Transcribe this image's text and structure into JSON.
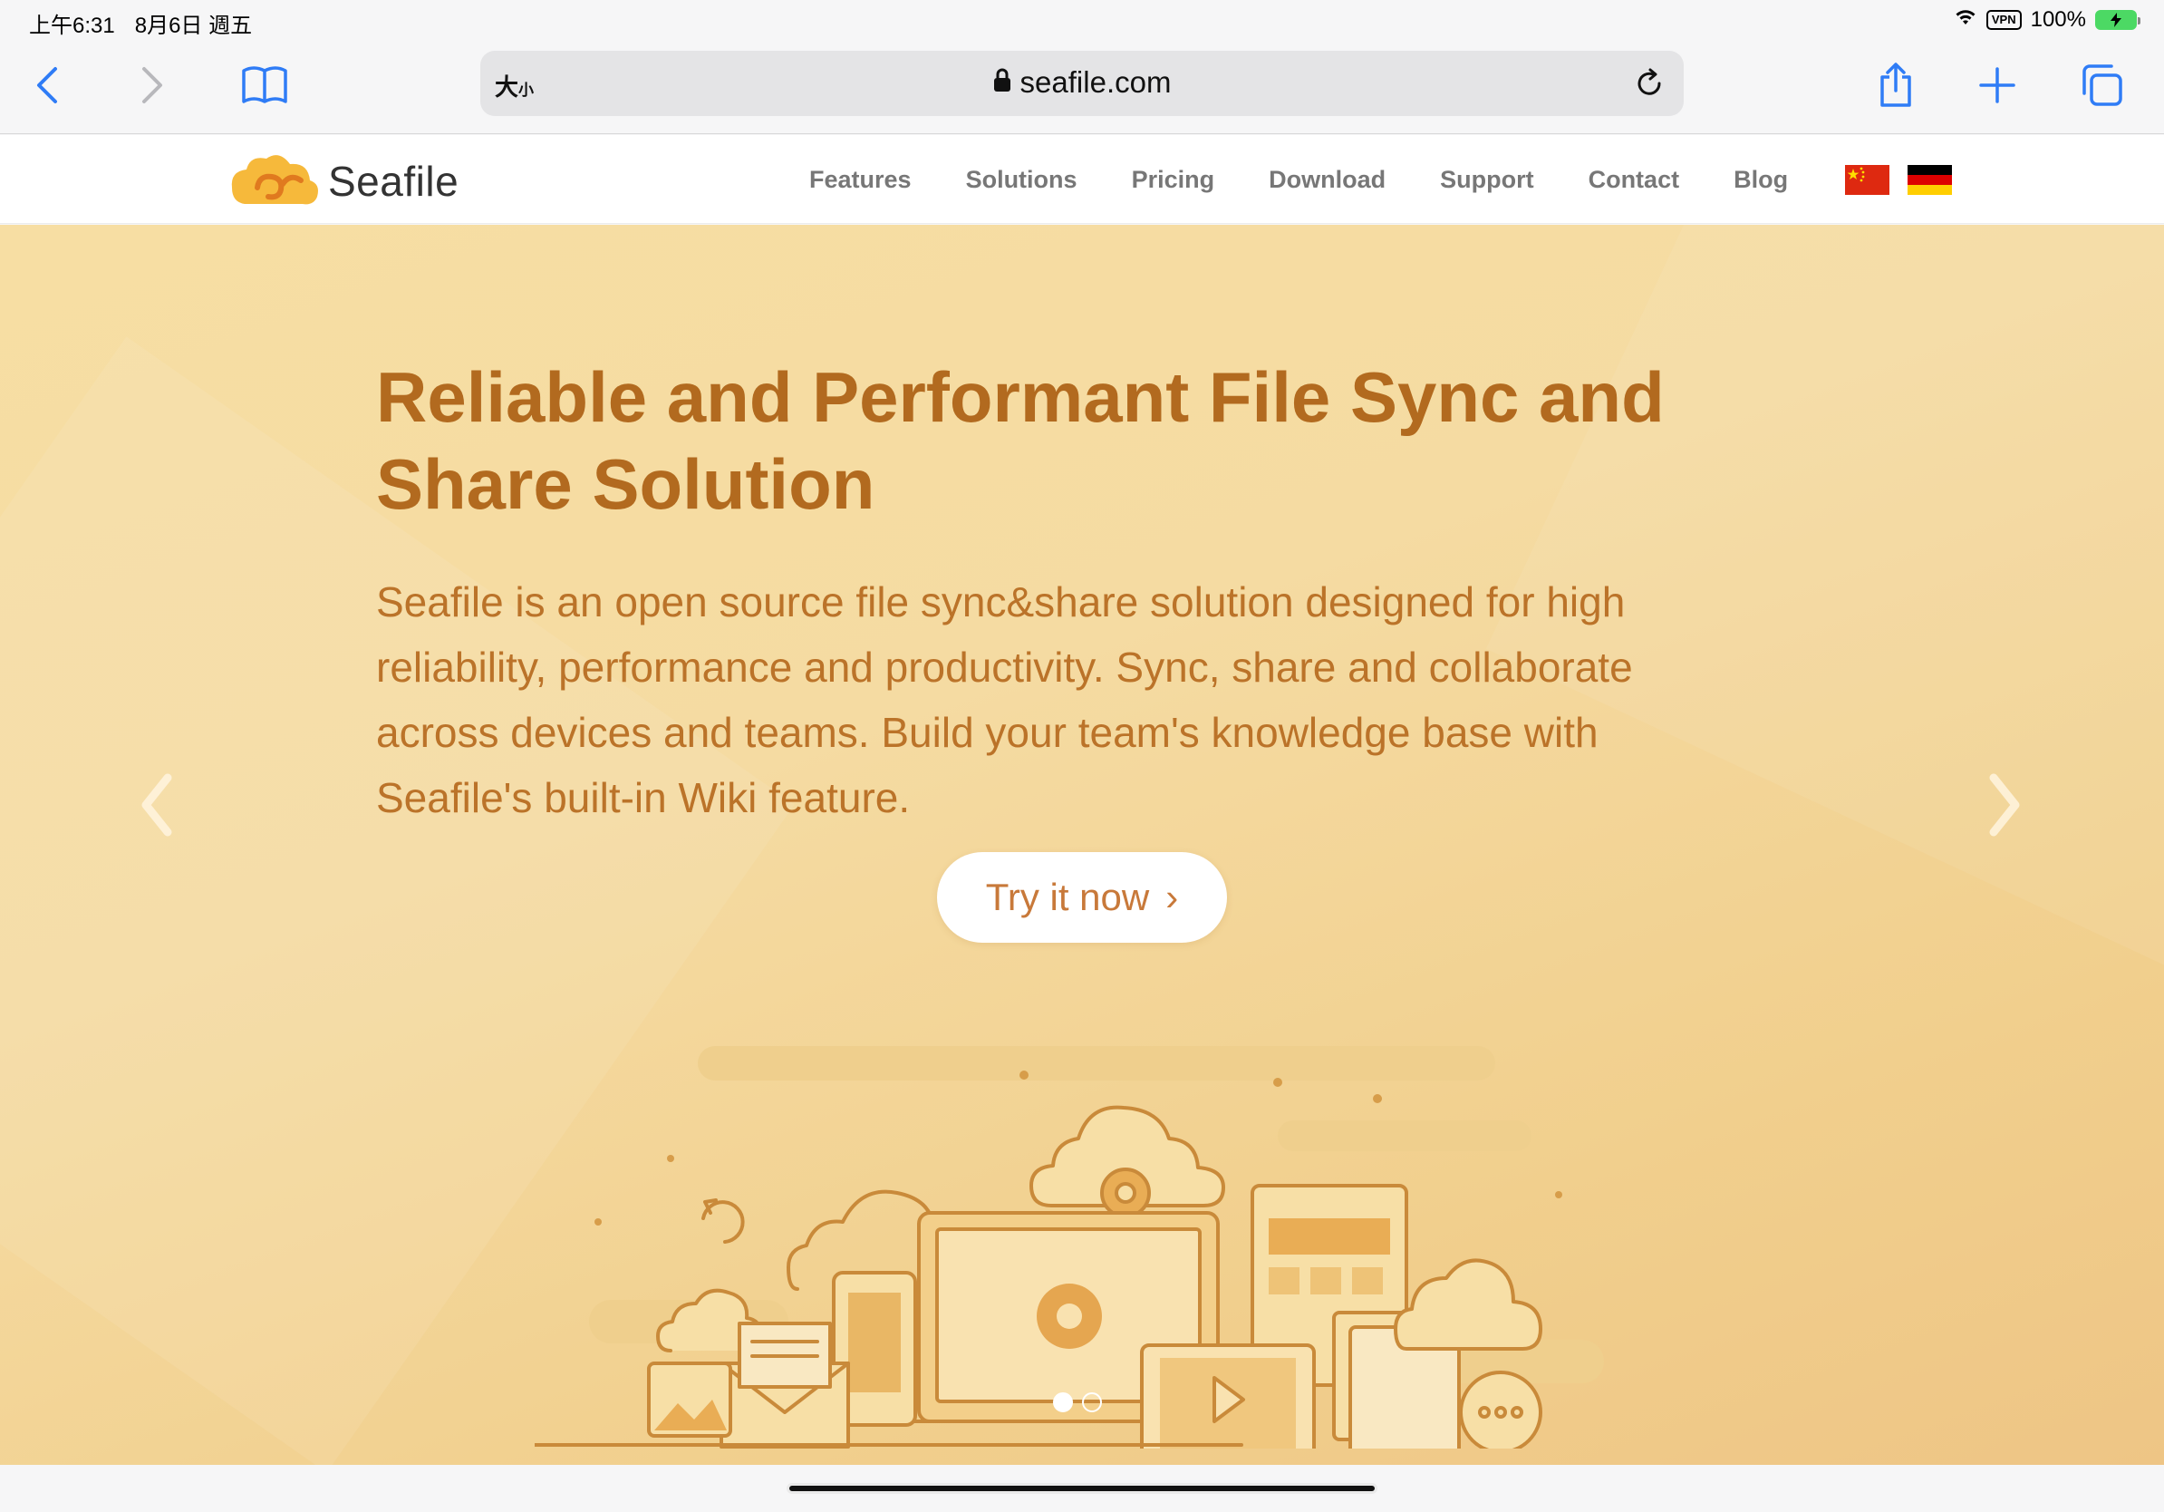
{
  "status_bar": {
    "time": "上午6:31",
    "date": "8月6日 週五",
    "vpn": "VPN",
    "battery": "100%"
  },
  "browser": {
    "text_size_label": "大",
    "text_size_small": "小",
    "url": "seafile.com"
  },
  "site": {
    "logo_text": "Seafile",
    "nav": [
      "Features",
      "Solutions",
      "Pricing",
      "Download",
      "Support",
      "Contact",
      "Blog"
    ]
  },
  "hero": {
    "title": "Reliable and Performant File Sync and Share Solution",
    "description": "Seafile is an open source file sync&share solution designed for high reliability, performance and productivity. Sync, share and collaborate across devices and teams. Build your team's knowledge base with Seafile's built-in Wiki feature.",
    "cta_label": "Try it now",
    "cta_chevron": "›"
  },
  "colors": {
    "accent": "#b26a1f",
    "hero_bg": "#f5dba2",
    "link": "#2f7cf6"
  }
}
